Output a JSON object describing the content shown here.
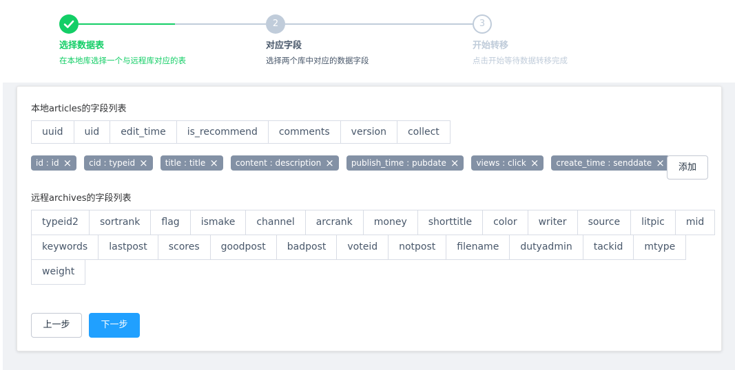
{
  "steps": [
    {
      "number": "",
      "title": "选择数据表",
      "desc": "在本地库选择一个与远程库对应的表",
      "status": "done"
    },
    {
      "number": "2",
      "title": "对应字段",
      "desc": "选择两个库中对应的数据字段",
      "status": "process"
    },
    {
      "number": "3",
      "title": "开始转移",
      "desc": "点击开始等待数据转移完成",
      "status": "wait"
    }
  ],
  "local": {
    "label": "本地articles的字段列表",
    "fields": [
      "uuid",
      "uid",
      "edit_time",
      "is_recommend",
      "comments",
      "version",
      "collect"
    ]
  },
  "mappings": [
    {
      "label": "id : id"
    },
    {
      "label": "cid : typeid"
    },
    {
      "label": "title : title"
    },
    {
      "label": "content : description"
    },
    {
      "label": "publish_time : pubdate"
    },
    {
      "label": "views : click"
    },
    {
      "label": "create_time : senddate"
    }
  ],
  "add_label": "添加",
  "remote": {
    "label": "远程archives的字段列表",
    "rows": [
      [
        "typeid2",
        "sortrank",
        "flag",
        "ismake",
        "channel",
        "arcrank",
        "money",
        "shorttitle",
        "color",
        "writer",
        "source",
        "litpic",
        "mid"
      ],
      [
        "keywords",
        "lastpost",
        "scores",
        "goodpost",
        "badpost",
        "voteid",
        "notpost",
        "filename",
        "dutyadmin",
        "tackid",
        "mtype"
      ],
      [
        "weight"
      ]
    ]
  },
  "buttons": {
    "prev": "上一步",
    "next": "下一步"
  },
  "colors": {
    "success": "#13ce66",
    "primary": "#20a0ff",
    "tag": "#8391a5",
    "step_pending": "#c0ccda"
  }
}
